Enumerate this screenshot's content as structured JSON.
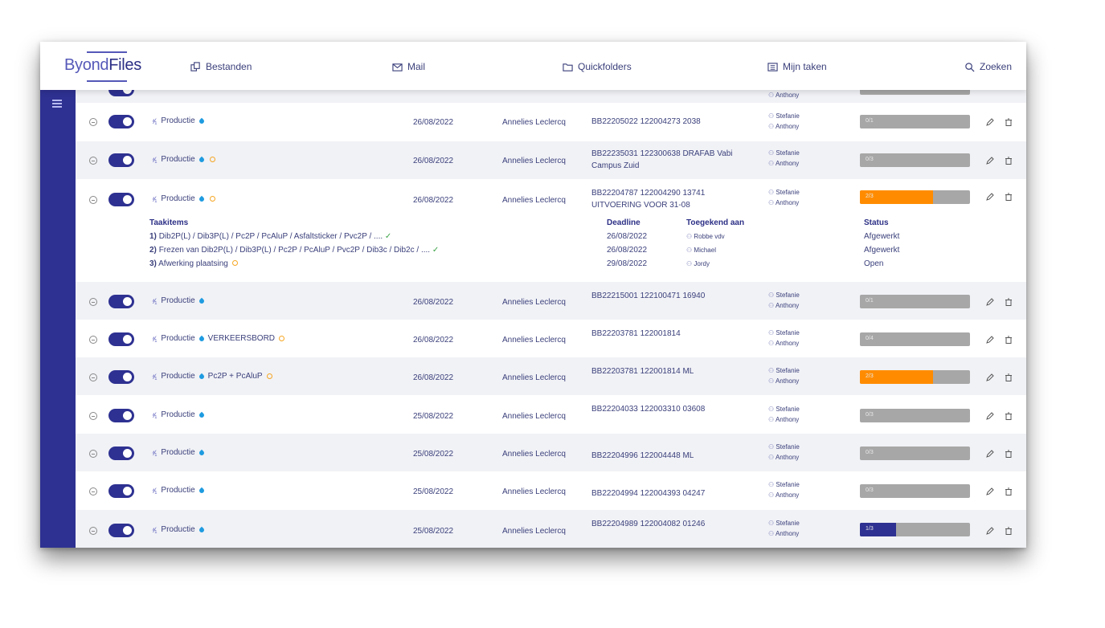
{
  "app": {
    "logo_part1": "Byond",
    "logo_part2": "Files"
  },
  "nav": {
    "bestanden": "Bestanden",
    "mail": "Mail",
    "quickfolders": "Quickfolders",
    "mijn_taken": "Mijn taken",
    "zoeken": "Zoeken"
  },
  "colors": {
    "primary": "#2e3191",
    "orange": "#ff8c00",
    "grey_bar": "#a7a7a7"
  },
  "partial_row": {
    "user": "Anthony"
  },
  "rows": [
    {
      "name": "Productie",
      "extra": "",
      "alarm": false,
      "date": "26/08/2022",
      "owner": "Annelies Leclercq",
      "ref_line1": "BB22205022 122004273 2038",
      "ref_line2": "",
      "user1": "Stefanie",
      "user2": "Anthony",
      "progress": "0/1",
      "progress_fraction": 0
    },
    {
      "name": "Productie",
      "extra": "",
      "alarm": true,
      "date": "26/08/2022",
      "owner": "Annelies Leclercq",
      "ref_line1": "BB22235031 122300638 DRAFAB Vabi",
      "ref_line2": "Campus Zuid",
      "user1": "Stefanie",
      "user2": "Anthony",
      "progress": "0/3",
      "progress_fraction": 0
    },
    {
      "name": "Productie",
      "extra": "",
      "alarm": true,
      "date": "26/08/2022",
      "owner": "Annelies Leclercq",
      "ref_line1": "BB22204787 122004290 13741",
      "ref_line2": "UITVOERING VOOR 31-08",
      "user1": "Stefanie",
      "user2": "Anthony",
      "progress": "2/3",
      "progress_fraction": 0.667
    },
    {
      "name": "Productie",
      "extra": "",
      "alarm": false,
      "date": "26/08/2022",
      "owner": "Annelies Leclercq",
      "ref_line1": "BB22215001 122100471 16940",
      "ref_line2": "",
      "user1": "Stefanie",
      "user2": "Anthony",
      "progress": "0/1",
      "progress_fraction": 0
    },
    {
      "name": "Productie",
      "extra": "VERKEERSBORD",
      "alarm": true,
      "date": "26/08/2022",
      "owner": "Annelies Leclercq",
      "ref_line1": "BB22203781 122001814",
      "ref_line2": "",
      "user1": "Stefanie",
      "user2": "Anthony",
      "progress": "0/4",
      "progress_fraction": 0
    },
    {
      "name": "Productie",
      "extra": "Pc2P + PcAluP",
      "alarm": true,
      "date": "26/08/2022",
      "owner": "Annelies Leclercq",
      "ref_line1": "BB22203781 122001814 ML",
      "ref_line2": "",
      "user1": "Stefanie",
      "user2": "Anthony",
      "progress": "2/3",
      "progress_fraction": 0.667
    },
    {
      "name": "Productie",
      "extra": "",
      "alarm": false,
      "date": "25/08/2022",
      "owner": "Annelies Leclercq",
      "ref_line1": "BB22204033 122003310 03608",
      "ref_line2": "",
      "user1": "Stefanie",
      "user2": "Anthony",
      "progress": "0/3",
      "progress_fraction": 0
    },
    {
      "name": "Productie",
      "extra": "",
      "alarm": false,
      "date": "25/08/2022",
      "owner": "Annelies Leclercq",
      "ref_line1": "BB22204996 122004448 ML",
      "ref_line2": "",
      "user1": "Stefanie",
      "user2": "Anthony",
      "progress": "0/3",
      "progress_fraction": 0
    },
    {
      "name": "Productie",
      "extra": "",
      "alarm": false,
      "date": "25/08/2022",
      "owner": "Annelies Leclercq",
      "ref_line1": "BB22204994 122004393 04247",
      "ref_line2": "",
      "user1": "Stefanie",
      "user2": "Anthony",
      "progress": "0/3",
      "progress_fraction": 0
    },
    {
      "name": "Productie",
      "extra": "",
      "alarm": false,
      "date": "25/08/2022",
      "owner": "Annelies Leclercq",
      "ref_line1": "BB22204989 122004082 01246",
      "ref_line2": "",
      "user1": "Stefanie",
      "user2": "Anthony",
      "progress": "1/3",
      "progress_fraction": 0.333
    }
  ],
  "detail": {
    "items_header": "Taakitems",
    "items": [
      {
        "num": "1)",
        "text": "Dib2P(L) / Dib3P(L) / Pc2P / PcAluP / Asfaltsticker / Pvc2P / ....",
        "mark": "✓"
      },
      {
        "num": "2)",
        "text": "Frezen van Dib2P(L) / Dib3P(L) / Pc2P / PcAluP / Pvc2P / Dib3c / Dib2c / ....",
        "mark": "✓"
      },
      {
        "num": "3)",
        "text": "Afwerking plaatsing",
        "mark": ""
      }
    ],
    "deadline_header": "Deadline",
    "deadlines": [
      "26/08/2022",
      "26/08/2022",
      "29/08/2022"
    ],
    "assigned_header": "Toegekend aan",
    "assigned": [
      "Robbe vdv",
      "Michael",
      "Jordy"
    ],
    "status_header": "Status",
    "statuses": [
      "Afgewerkt",
      "Afgewerkt",
      "Open"
    ]
  }
}
